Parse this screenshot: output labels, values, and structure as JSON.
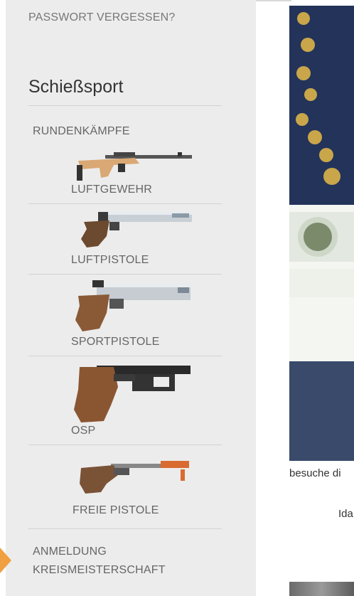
{
  "sidebar": {
    "forgot_password": "PASSWORT VERGESSEN?",
    "section_title": "Schießsport",
    "rundenkaempfe": "RUNDENKÄMPFE",
    "items": [
      {
        "label": "LUFTGEWEHR",
        "icon": "air-rifle-icon"
      },
      {
        "label": "LUFTPISTOLE",
        "icon": "air-pistol-icon"
      },
      {
        "label": "SPORTPISTOLE",
        "icon": "sport-pistol-icon"
      },
      {
        "label": "OSP",
        "icon": "osp-pistol-icon"
      },
      {
        "label": "FREIE PISTOLE",
        "icon": "free-pistol-icon"
      }
    ],
    "anmeldung_line1": "ANMELDUNG",
    "anmeldung_line2": "KREISMEISTERSCHAFT"
  },
  "content": {
    "caption": "besuche di",
    "caption2": "Ida"
  },
  "colors": {
    "sidebar_bg": "#ececec",
    "link_gray": "#666666",
    "accent_orange": "#f0a040"
  }
}
